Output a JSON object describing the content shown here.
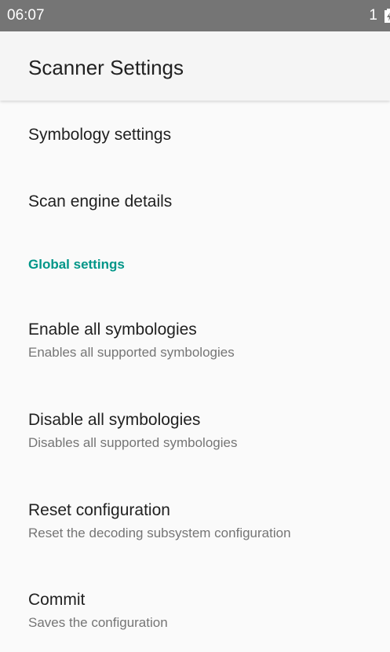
{
  "status_bar": {
    "time": "06:07",
    "notification_count": "1",
    "battery_icon": "battery-charging-icon"
  },
  "toolbar": {
    "title": "Scanner Settings"
  },
  "preferences": [
    {
      "title": "Symbology settings"
    },
    {
      "title": "Scan engine details"
    }
  ],
  "category": {
    "title": "Global settings",
    "color": "#009688"
  },
  "global_settings": [
    {
      "title": "Enable all symbologies",
      "summary": "Enables all supported symbologies"
    },
    {
      "title": "Disable all symbologies",
      "summary": "Disables all supported symbologies"
    },
    {
      "title": "Reset configuration",
      "summary": "Reset the decoding subsystem configuration"
    },
    {
      "title": "Commit",
      "summary": "Saves the configuration"
    }
  ]
}
